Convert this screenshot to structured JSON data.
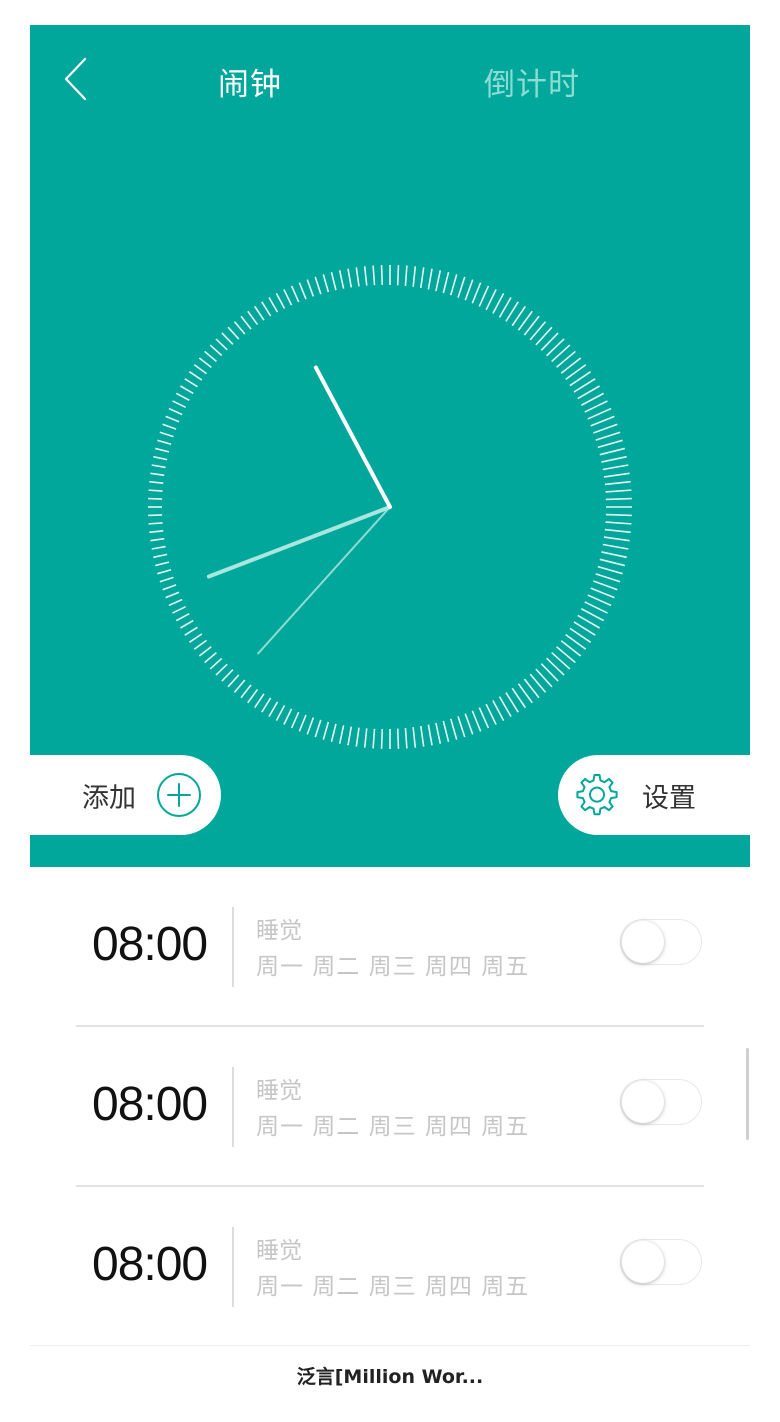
{
  "header": {
    "tabs": [
      {
        "label": "闹钟",
        "active": true
      },
      {
        "label": "倒计时",
        "active": false
      }
    ]
  },
  "clock": {
    "hour_hand_angle_deg": -28,
    "minute_hand_angle_deg": 249,
    "second_hand_angle_deg": 222
  },
  "actions": {
    "add_label": "添加",
    "settings_label": "设置"
  },
  "alarms": [
    {
      "time": "08:00",
      "label": "睡觉",
      "days": "周一 周二 周三 周四 周五",
      "enabled": false
    },
    {
      "time": "08:00",
      "label": "睡觉",
      "days": "周一 周二 周三 周四 周五",
      "enabled": false
    },
    {
      "time": "08:00",
      "label": "睡觉",
      "days": "周一 周二 周三 周四 周五",
      "enabled": false
    }
  ],
  "bottom_bar": {
    "title": "泛言[Million Wor..."
  },
  "colors": {
    "accent": "#00A79A",
    "tab_inactive": "#8BDCD3",
    "muted_text": "#C6C6C6"
  },
  "icons": {
    "back": "chevron-left-icon",
    "add": "plus-circle-icon",
    "settings": "gear-icon"
  }
}
